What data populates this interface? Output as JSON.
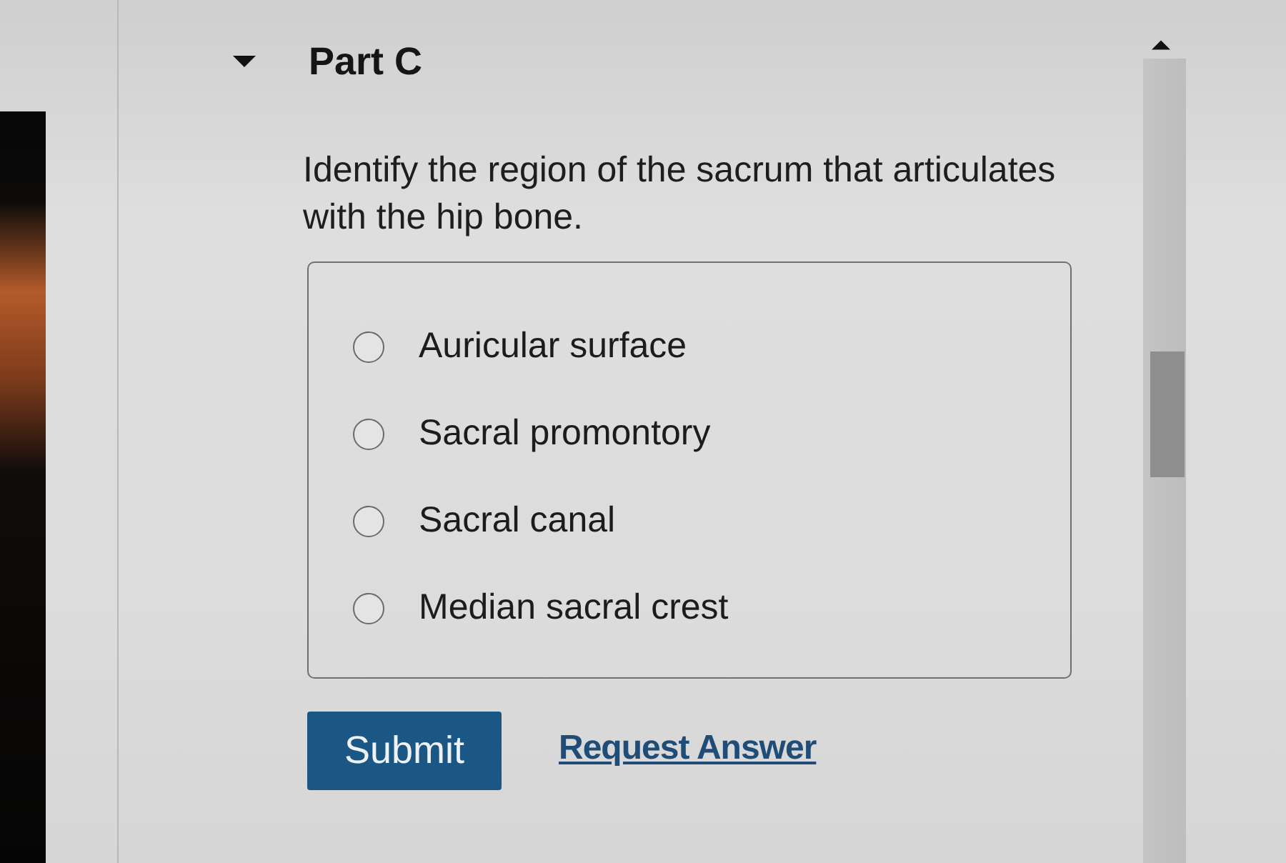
{
  "part": {
    "title": "Part C",
    "expanded": true
  },
  "question": "Identify the region of the sacrum that articulates with the hip bone.",
  "options": [
    {
      "label": "Auricular surface",
      "selected": false
    },
    {
      "label": "Sacral promontory",
      "selected": false
    },
    {
      "label": "Sacral canal",
      "selected": false
    },
    {
      "label": "Median sacral crest",
      "selected": false
    }
  ],
  "actions": {
    "submit": "Submit",
    "request_answer": "Request Answer"
  }
}
